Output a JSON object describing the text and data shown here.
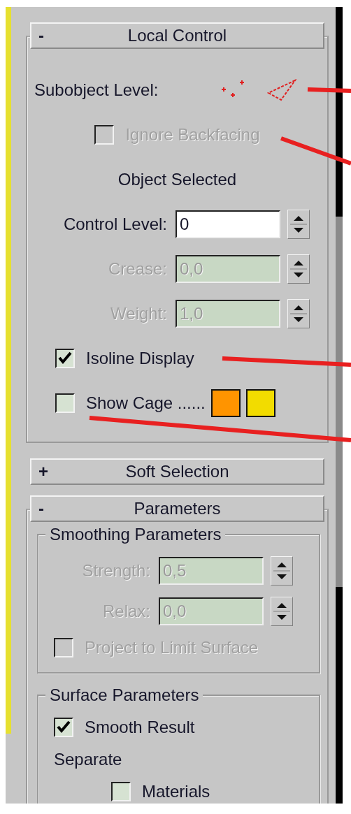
{
  "rollouts": [
    {
      "title": "Local Control",
      "sign": "-",
      "expanded": true,
      "items": [
        {
          "kind": "subobject",
          "label": "Subobject Level:"
        },
        {
          "kind": "centered_checkbox",
          "label": "Ignore Backfacing",
          "checked": false,
          "disabled": true
        },
        {
          "kind": "status",
          "text": "Object Selected"
        },
        {
          "kind": "spinner",
          "label": "Control Level:",
          "value": "0",
          "disabled": false
        },
        {
          "kind": "spinner",
          "label": "Crease:",
          "value": "0,0",
          "disabled": true
        },
        {
          "kind": "spinner",
          "label": "Weight:",
          "value": "1,0",
          "disabled": true
        },
        {
          "kind": "checkbox",
          "label": "Isoline Display",
          "checked": true,
          "disabled": false
        },
        {
          "kind": "checkbox",
          "label": "Show Cage ......",
          "checked": false,
          "disabled": false,
          "swatches": [
            {
              "color": "#ff9400"
            },
            {
              "color": "#f2dc00"
            }
          ]
        }
      ]
    },
    {
      "title": "Soft Selection",
      "sign": "+",
      "expanded": false
    },
    {
      "title": "Parameters",
      "sign": "-",
      "expanded": true,
      "items": [
        {
          "kind": "group",
          "title": "Smoothing Parameters",
          "items": [
            {
              "kind": "spinner",
              "label": "Strength:",
              "value": "0,5",
              "disabled": true
            },
            {
              "kind": "spinner",
              "label": "Relax:",
              "value": "0,0",
              "disabled": true
            },
            {
              "kind": "checkbox",
              "label": "Project to Limit Surface",
              "checked": false,
              "disabled": true
            }
          ]
        },
        {
          "kind": "group",
          "title": "Surface Parameters",
          "items": [
            {
              "kind": "checkbox",
              "label": "Smooth Result",
              "checked": true,
              "disabled": false
            },
            {
              "kind": "label",
              "text": "Separate",
              "children": [
                {
                  "kind": "checkbox",
                  "label": "Materials",
                  "checked": false,
                  "disabled": false
                }
              ]
            }
          ]
        }
      ]
    }
  ]
}
